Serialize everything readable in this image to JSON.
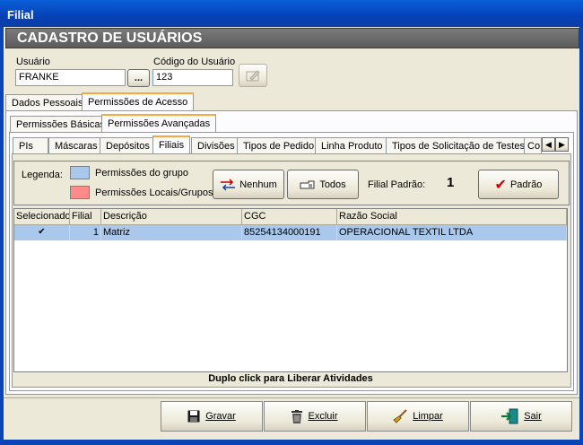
{
  "window": {
    "title": "Filial"
  },
  "header": {
    "title": "CADASTRO DE USUÁRIOS"
  },
  "user_form": {
    "usuario_label": "Usuário",
    "usuario_value": "FRANKE",
    "browse_label": "...",
    "codigo_label": "Código do Usuário",
    "codigo_value": "123"
  },
  "main_tabs": [
    {
      "label": "Dados Pessoais"
    },
    {
      "label": "Permissões de Acesso"
    }
  ],
  "perm_tabs": [
    {
      "label": "Permissões Básicas"
    },
    {
      "label": "Permissões Avançadas"
    }
  ],
  "detail_tabs": [
    {
      "label": "PIs"
    },
    {
      "label": "Máscaras"
    },
    {
      "label": "Depósitos"
    },
    {
      "label": "Filiais"
    },
    {
      "label": "Divisões"
    },
    {
      "label": "Tipos de Pedido"
    },
    {
      "label": "Linha Produto"
    },
    {
      "label": "Tipos de Solicitação de Testes"
    },
    {
      "label": "Co"
    }
  ],
  "legend": {
    "label": "Legenda:",
    "group_label": "Permissões do grupo",
    "group_color": "#a9c8ec",
    "local_label": "Permissões Locais/Grupos",
    "local_color": "#ff8a8a"
  },
  "actions": {
    "nenhum_label": "Nenhum",
    "todos_label": "Todos",
    "filial_padrao_label": "Filial Padrão:",
    "filial_padrao_value": "1",
    "padrao_label": "Padrão"
  },
  "grid": {
    "columns": [
      "Selecionado",
      "Filial",
      "Descrição",
      "CGC",
      "Razão Social"
    ],
    "rows": [
      {
        "selecionado": "✔",
        "filial": "1",
        "descricao": "Matriz",
        "cgc": "85254134000191",
        "razao_social": "OPERACIONAL TEXTIL LTDA"
      }
    ]
  },
  "footer_hint": "Duplo click para Liberar Atividades",
  "bottom_buttons": {
    "gravar": "Gravar",
    "excluir": "Excluir",
    "limpar": "Limpar",
    "sair": "Sair"
  }
}
